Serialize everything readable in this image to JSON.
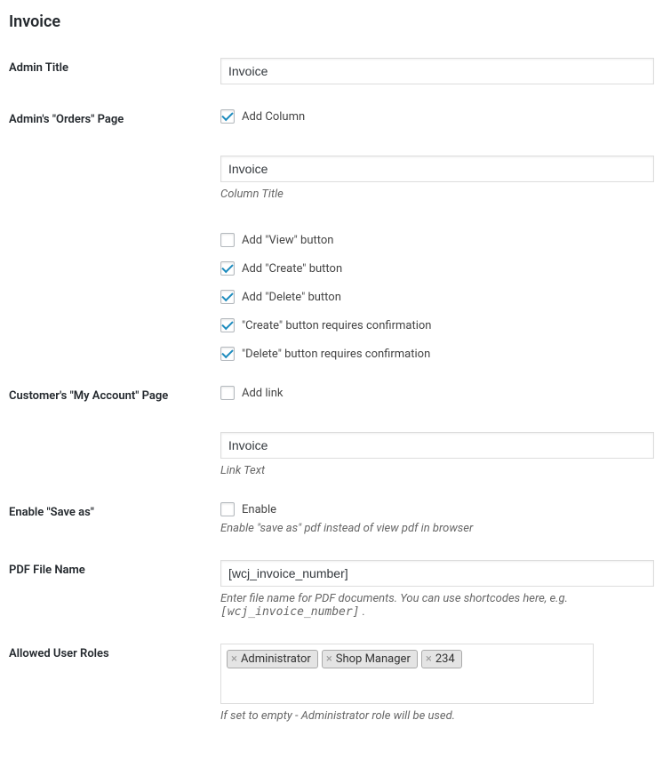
{
  "section_title": "Invoice",
  "admin_title": {
    "label": "Admin Title",
    "value": "Invoice"
  },
  "admin_orders": {
    "label": "Admin's \"Orders\" Page",
    "add_column": {
      "checked": true,
      "label": "Add Column"
    },
    "column_title_value": "Invoice",
    "column_title_help": "Column Title",
    "checkboxes": [
      {
        "checked": false,
        "label": "Add \"View\" button"
      },
      {
        "checked": true,
        "label": "Add \"Create\" button"
      },
      {
        "checked": true,
        "label": "Add \"Delete\" button"
      },
      {
        "checked": true,
        "label": "\"Create\" button requires confirmation"
      },
      {
        "checked": true,
        "label": "\"Delete\" button requires confirmation"
      }
    ]
  },
  "customer_account": {
    "label": "Customer's \"My Account\" Page",
    "add_link": {
      "checked": false,
      "label": "Add link"
    },
    "link_text_value": "Invoice",
    "link_text_help": "Link Text"
  },
  "enable_save_as": {
    "label": "Enable \"Save as\"",
    "checkbox": {
      "checked": false,
      "label": "Enable"
    },
    "help": "Enable \"save as\" pdf instead of view pdf in browser"
  },
  "pdf_filename": {
    "label": "PDF File Name",
    "value": "[wcj_invoice_number]",
    "help_prefix": "Enter file name for PDF documents. You can use shortcodes here, e.g. ",
    "help_code": "[wcj_invoice_number]",
    "help_suffix": " ."
  },
  "allowed_roles": {
    "label": "Allowed User Roles",
    "tags": [
      {
        "name": "Administrator"
      },
      {
        "name": "Shop Manager"
      },
      {
        "name": "234"
      }
    ],
    "help": "If set to empty - Administrator role will be used."
  }
}
